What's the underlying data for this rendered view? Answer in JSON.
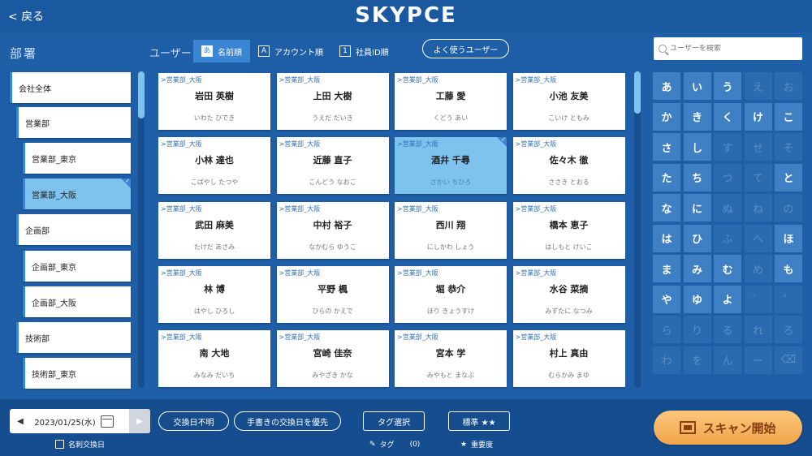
{
  "header": {
    "back_label": "< 戻る",
    "logo": "SKYPCE"
  },
  "departments": {
    "title": "部署",
    "items": [
      {
        "label": "会社全体",
        "selected": false
      },
      {
        "label": "営業部",
        "selected": false
      },
      {
        "label": "営業部_東京",
        "selected": false
      },
      {
        "label": "営業部_大阪",
        "selected": true
      },
      {
        "label": "企画部",
        "selected": false
      },
      {
        "label": "企画部_東京",
        "selected": false
      },
      {
        "label": "企画部_大阪",
        "selected": false
      },
      {
        "label": "技術部",
        "selected": false
      },
      {
        "label": "技術部_東京",
        "selected": false
      }
    ]
  },
  "users": {
    "label": "ユーザー",
    "sort": [
      {
        "key": "あ",
        "label": "名前順",
        "active": true
      },
      {
        "key": "A",
        "label": "アカウント順",
        "active": false
      },
      {
        "key": "1",
        "label": "社員ID順",
        "active": false
      }
    ],
    "favorite_label": "よく使うユーザー",
    "search_placeholder": "ユーザーを検索",
    "cards": [
      {
        "dept": ">営業部_大阪",
        "name": "岩田 英樹",
        "kana": "いわた ひでき",
        "selected": false
      },
      {
        "dept": ">営業部_大阪",
        "name": "上田 大樹",
        "kana": "うえだ だいき",
        "selected": false
      },
      {
        "dept": ">営業部_大阪",
        "name": "工藤 愛",
        "kana": "くどう あい",
        "selected": false
      },
      {
        "dept": ">営業部_大阪",
        "name": "小池 友美",
        "kana": "こいけ ともみ",
        "selected": false
      },
      {
        "dept": ">営業部_大阪",
        "name": "小林 達也",
        "kana": "こばやし たつや",
        "selected": false
      },
      {
        "dept": ">営業部_大阪",
        "name": "近藤 直子",
        "kana": "こんどう なおこ",
        "selected": false
      },
      {
        "dept": ">営業部_大阪",
        "name": "酒井 千尋",
        "kana": "さかい ちひろ",
        "selected": true
      },
      {
        "dept": ">営業部_大阪",
        "name": "佐々木 徹",
        "kana": "ささき とおる",
        "selected": false
      },
      {
        "dept": ">営業部_大阪",
        "name": "武田 麻美",
        "kana": "たけだ あさみ",
        "selected": false
      },
      {
        "dept": ">営業部_大阪",
        "name": "中村 裕子",
        "kana": "なかむら ゆうこ",
        "selected": false
      },
      {
        "dept": ">営業部_大阪",
        "name": "西川 翔",
        "kana": "にしかわ しょう",
        "selected": false
      },
      {
        "dept": ">営業部_大阪",
        "name": "橋本 恵子",
        "kana": "はしもと けいこ",
        "selected": false
      },
      {
        "dept": ">営業部_大阪",
        "name": "林 博",
        "kana": "はやし ひろし",
        "selected": false
      },
      {
        "dept": ">営業部_大阪",
        "name": "平野 楓",
        "kana": "ひらの かえで",
        "selected": false
      },
      {
        "dept": ">営業部_大阪",
        "name": "堀 恭介",
        "kana": "ほり きょうすけ",
        "selected": false
      },
      {
        "dept": ">営業部_大阪",
        "name": "水谷 菜摘",
        "kana": "みずたに なつみ",
        "selected": false
      },
      {
        "dept": ">営業部_大阪",
        "name": "南 大地",
        "kana": "みなみ だいち",
        "selected": false
      },
      {
        "dept": ">営業部_大阪",
        "name": "宮崎 佳奈",
        "kana": "みやざき かな",
        "selected": false
      },
      {
        "dept": ">営業部_大阪",
        "name": "宮本 学",
        "kana": "みやもと まなぶ",
        "selected": false
      },
      {
        "dept": ">営業部_大阪",
        "name": "村上 真由",
        "kana": "むらかみ まゆ",
        "selected": false
      }
    ]
  },
  "kana_pad": {
    "rows": [
      [
        {
          "c": "あ",
          "on": true
        },
        {
          "c": "い",
          "on": true
        },
        {
          "c": "う",
          "on": true
        },
        {
          "c": "え",
          "on": false
        },
        {
          "c": "お",
          "on": false
        }
      ],
      [
        {
          "c": "か",
          "on": true
        },
        {
          "c": "き",
          "on": true
        },
        {
          "c": "く",
          "on": true
        },
        {
          "c": "け",
          "on": true
        },
        {
          "c": "こ",
          "on": true
        }
      ],
      [
        {
          "c": "さ",
          "on": true
        },
        {
          "c": "し",
          "on": true
        },
        {
          "c": "す",
          "on": false
        },
        {
          "c": "せ",
          "on": false
        },
        {
          "c": "そ",
          "on": false
        }
      ],
      [
        {
          "c": "た",
          "on": true
        },
        {
          "c": "ち",
          "on": true
        },
        {
          "c": "つ",
          "on": false
        },
        {
          "c": "て",
          "on": false
        },
        {
          "c": "と",
          "on": true
        }
      ],
      [
        {
          "c": "な",
          "on": true
        },
        {
          "c": "に",
          "on": true
        },
        {
          "c": "ぬ",
          "on": false
        },
        {
          "c": "ね",
          "on": false
        },
        {
          "c": "の",
          "on": false
        }
      ],
      [
        {
          "c": "は",
          "on": true
        },
        {
          "c": "ひ",
          "on": true
        },
        {
          "c": "ふ",
          "on": false
        },
        {
          "c": "へ",
          "on": false
        },
        {
          "c": "ほ",
          "on": true
        }
      ],
      [
        {
          "c": "ま",
          "on": true
        },
        {
          "c": "み",
          "on": true
        },
        {
          "c": "む",
          "on": true
        },
        {
          "c": "め",
          "on": false
        },
        {
          "c": "も",
          "on": true
        }
      ],
      [
        {
          "c": "や",
          "on": true
        },
        {
          "c": "ゆ",
          "on": true
        },
        {
          "c": "よ",
          "on": true
        },
        {
          "c": "゛",
          "on": false
        },
        {
          "c": "゜",
          "on": false
        }
      ],
      [
        {
          "c": "ら",
          "on": false
        },
        {
          "c": "り",
          "on": false
        },
        {
          "c": "る",
          "on": false
        },
        {
          "c": "れ",
          "on": false
        },
        {
          "c": "ろ",
          "on": false
        }
      ],
      [
        {
          "c": "わ",
          "on": false
        },
        {
          "c": "を",
          "on": false
        },
        {
          "c": "ん",
          "on": false
        },
        {
          "c": "ー",
          "on": false
        },
        {
          "c": "⌫",
          "on": false
        }
      ]
    ]
  },
  "footer": {
    "date": "2023/01/25(水)",
    "date_caption": "名刺交換日",
    "unknown_date": "交換日不明",
    "handwritten_priority": "手書きの交換日を優先",
    "tag_select": "タグ選択",
    "tag_label": "タグ",
    "tag_count": "(0)",
    "importance": "標準 ★★",
    "importance_caption": "重要度",
    "scan_label": "スキャン開始"
  }
}
